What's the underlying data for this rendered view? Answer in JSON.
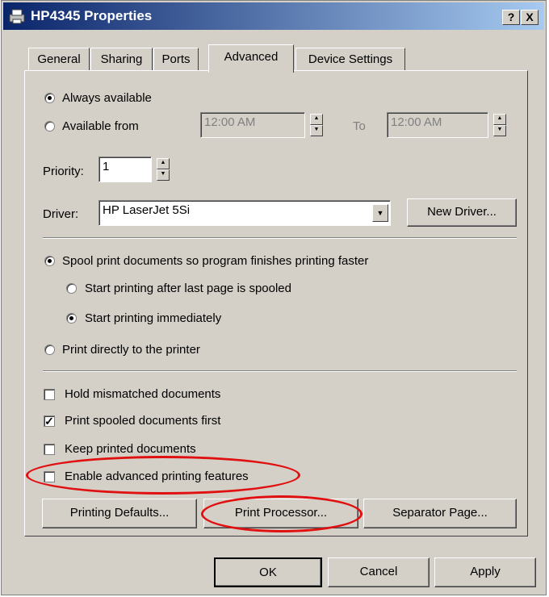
{
  "window": {
    "title": "HP4345 Properties",
    "help_button": "?",
    "close_button": "X"
  },
  "tabs": [
    {
      "label": "General"
    },
    {
      "label": "Sharing"
    },
    {
      "label": "Ports"
    },
    {
      "label": "Advanced",
      "active": true
    },
    {
      "label": "Device Settings"
    }
  ],
  "availability": {
    "always_label": "Always available",
    "from_label": "Available from",
    "from_time": "12:00 AM",
    "to_label": "To",
    "to_time": "12:00 AM",
    "selected": "always"
  },
  "priority": {
    "label": "Priority:",
    "value": "1"
  },
  "driver": {
    "label": "Driver:",
    "value": "HP LaserJet 5Si",
    "new_driver_button": "New Driver..."
  },
  "spooling": {
    "spool_label": "Spool print documents so program finishes printing faster",
    "start_after_last_label": "Start printing after last page is spooled",
    "start_immediately_label": "Start printing immediately",
    "direct_label": "Print directly to the printer"
  },
  "options": {
    "hold_mismatched": {
      "label": "Hold mismatched documents",
      "checked": false
    },
    "print_spooled_first": {
      "label": "Print spooled documents first",
      "checked": true
    },
    "keep_printed": {
      "label": "Keep printed documents",
      "checked": false
    },
    "enable_advanced": {
      "label": "Enable advanced printing features",
      "checked": false
    }
  },
  "buttons": {
    "printing_defaults": "Printing Defaults...",
    "print_processor": "Print Processor...",
    "separator_page": "Separator Page...",
    "ok": "OK",
    "cancel": "Cancel",
    "apply": "Apply"
  },
  "colors": {
    "highlight_annotation": "#e01010",
    "titlebar": "#0a246a"
  }
}
